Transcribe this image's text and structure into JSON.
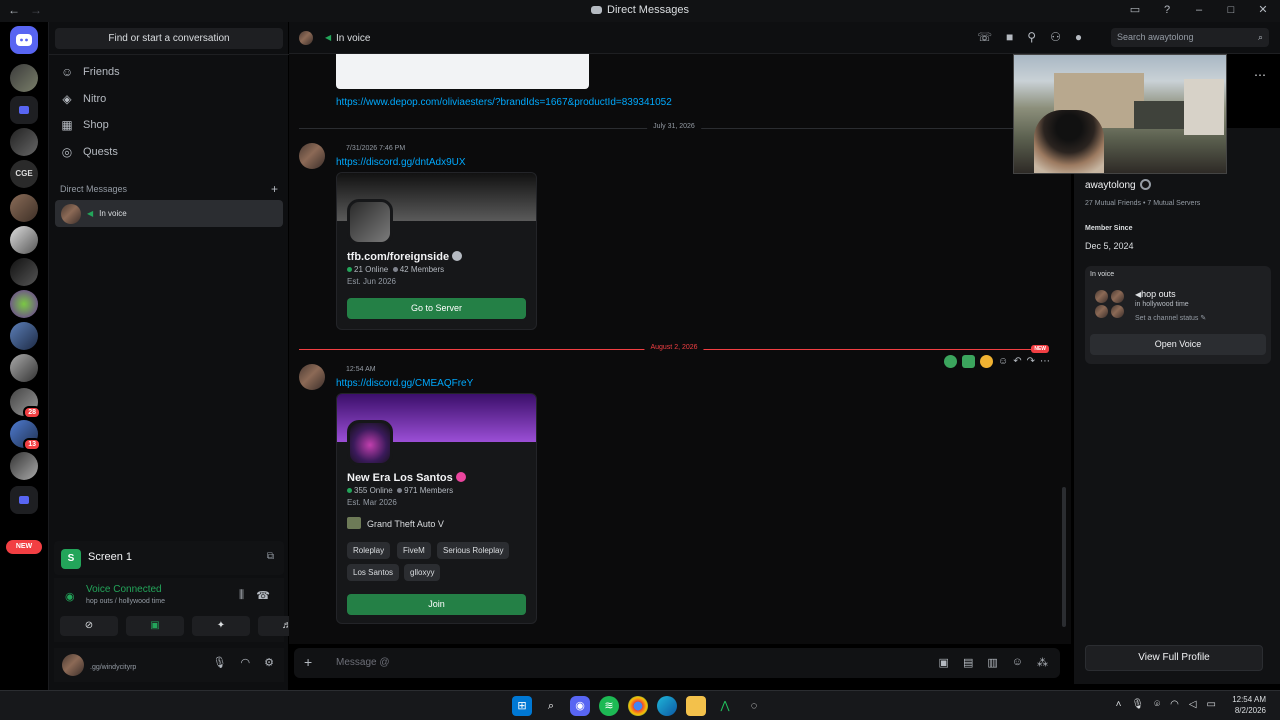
{
  "titlebar": {
    "title": "Direct Messages",
    "back": "←",
    "forward": "→"
  },
  "servers": {
    "new_label": "NEW",
    "badges": [
      "28",
      "13"
    ]
  },
  "dm_panel": {
    "search_placeholder": "Find or start a conversation",
    "nav": [
      {
        "label": "Friends",
        "icon": "friends-icon"
      },
      {
        "label": "Nitro",
        "icon": "nitro-icon"
      },
      {
        "label": "Shop",
        "icon": "shop-icon"
      },
      {
        "label": "Quests",
        "icon": "quests-icon"
      }
    ],
    "section_label": "Direct Messages",
    "dm_item_status": "In voice"
  },
  "screen_share": {
    "label": "Screen 1"
  },
  "voice": {
    "status": "Voice Connected",
    "channel": "hop outs / hollywood time"
  },
  "user": {
    "name": ".gg/windycityrp"
  },
  "chat_header": {
    "status": "In voice",
    "search_placeholder": "Search awaytolong"
  },
  "chat": {
    "link_top": "https://www.depop.com/oliviaesters/?brandIds=1667&productId=839341052",
    "divider1": "July 31, 2026",
    "msg1_time": "7/31/2026 7:46 PM",
    "msg1_link": "https://discord.gg/dntAdx9UX",
    "invite1": {
      "name": "tfb.com/foreignside",
      "online": "21 Online",
      "members": "42 Members",
      "est": "Est. Jun 2026",
      "button": "Go to Server"
    },
    "divider2": "August 2, 2026",
    "new_tag": "NEW",
    "msg2_time": "12:54 AM",
    "msg2_link": "https://discord.gg/CMEAQFreY",
    "invite2": {
      "name": "New Era Los Santos",
      "online": "355 Online",
      "members": "971 Members",
      "est": "Est. Mar 2026",
      "game": "Grand Theft Auto V",
      "tags": [
        "Roleplay",
        "FiveM",
        "Serious Roleplay",
        "Los Santos",
        "glloxyy"
      ],
      "button": "Join"
    },
    "composer_placeholder": "Message @"
  },
  "profile": {
    "name": "awaytolong",
    "mutual_friends": "27 Mutual Friends",
    "mutual_servers": "7 Mutual Servers",
    "member_since_label": "Member Since",
    "member_since": "Dec 5, 2024",
    "in_voice_label": "In voice",
    "channel": "hop outs",
    "sub": "in hollywood time",
    "channel_status": "Set a channel status",
    "open_voice": "Open Voice",
    "view_full": "View Full Profile"
  },
  "taskbar": {
    "time": "12:54 AM",
    "date": "8/2/2026"
  },
  "colors": {
    "accent": "#5865f2",
    "green": "#23a55a",
    "red": "#f23f43",
    "link": "#00a8fc"
  }
}
